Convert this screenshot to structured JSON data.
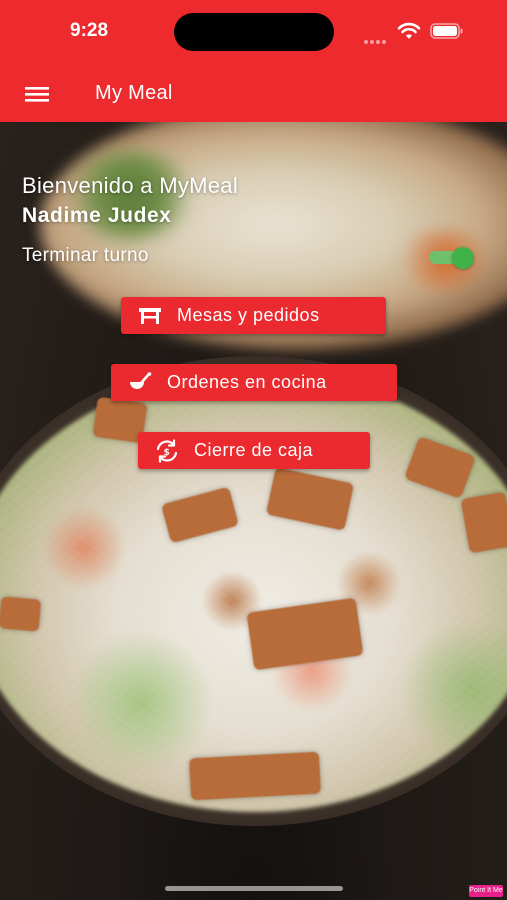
{
  "status_bar": {
    "time": "9:28"
  },
  "app_bar": {
    "title": "My Meal",
    "menu_icon": "hamburger-menu-icon"
  },
  "welcome": {
    "greeting": "Bienvenido a MyMeal",
    "user_name": "Nadime Judex",
    "shift_label": "Terminar turno",
    "shift_toggle_on": true
  },
  "actions": [
    {
      "label": "Mesas y pedidos",
      "icon": "table-icon"
    },
    {
      "label": "Ordenes en cocina",
      "icon": "ladle-icon"
    },
    {
      "label": "Cierre de caja",
      "icon": "cash-sync-icon"
    }
  ],
  "colors": {
    "primary": "#ed2a2e",
    "button": "#ea2a2f",
    "toggle_on": "#3fb24a"
  },
  "badge_text": "Point It Me"
}
